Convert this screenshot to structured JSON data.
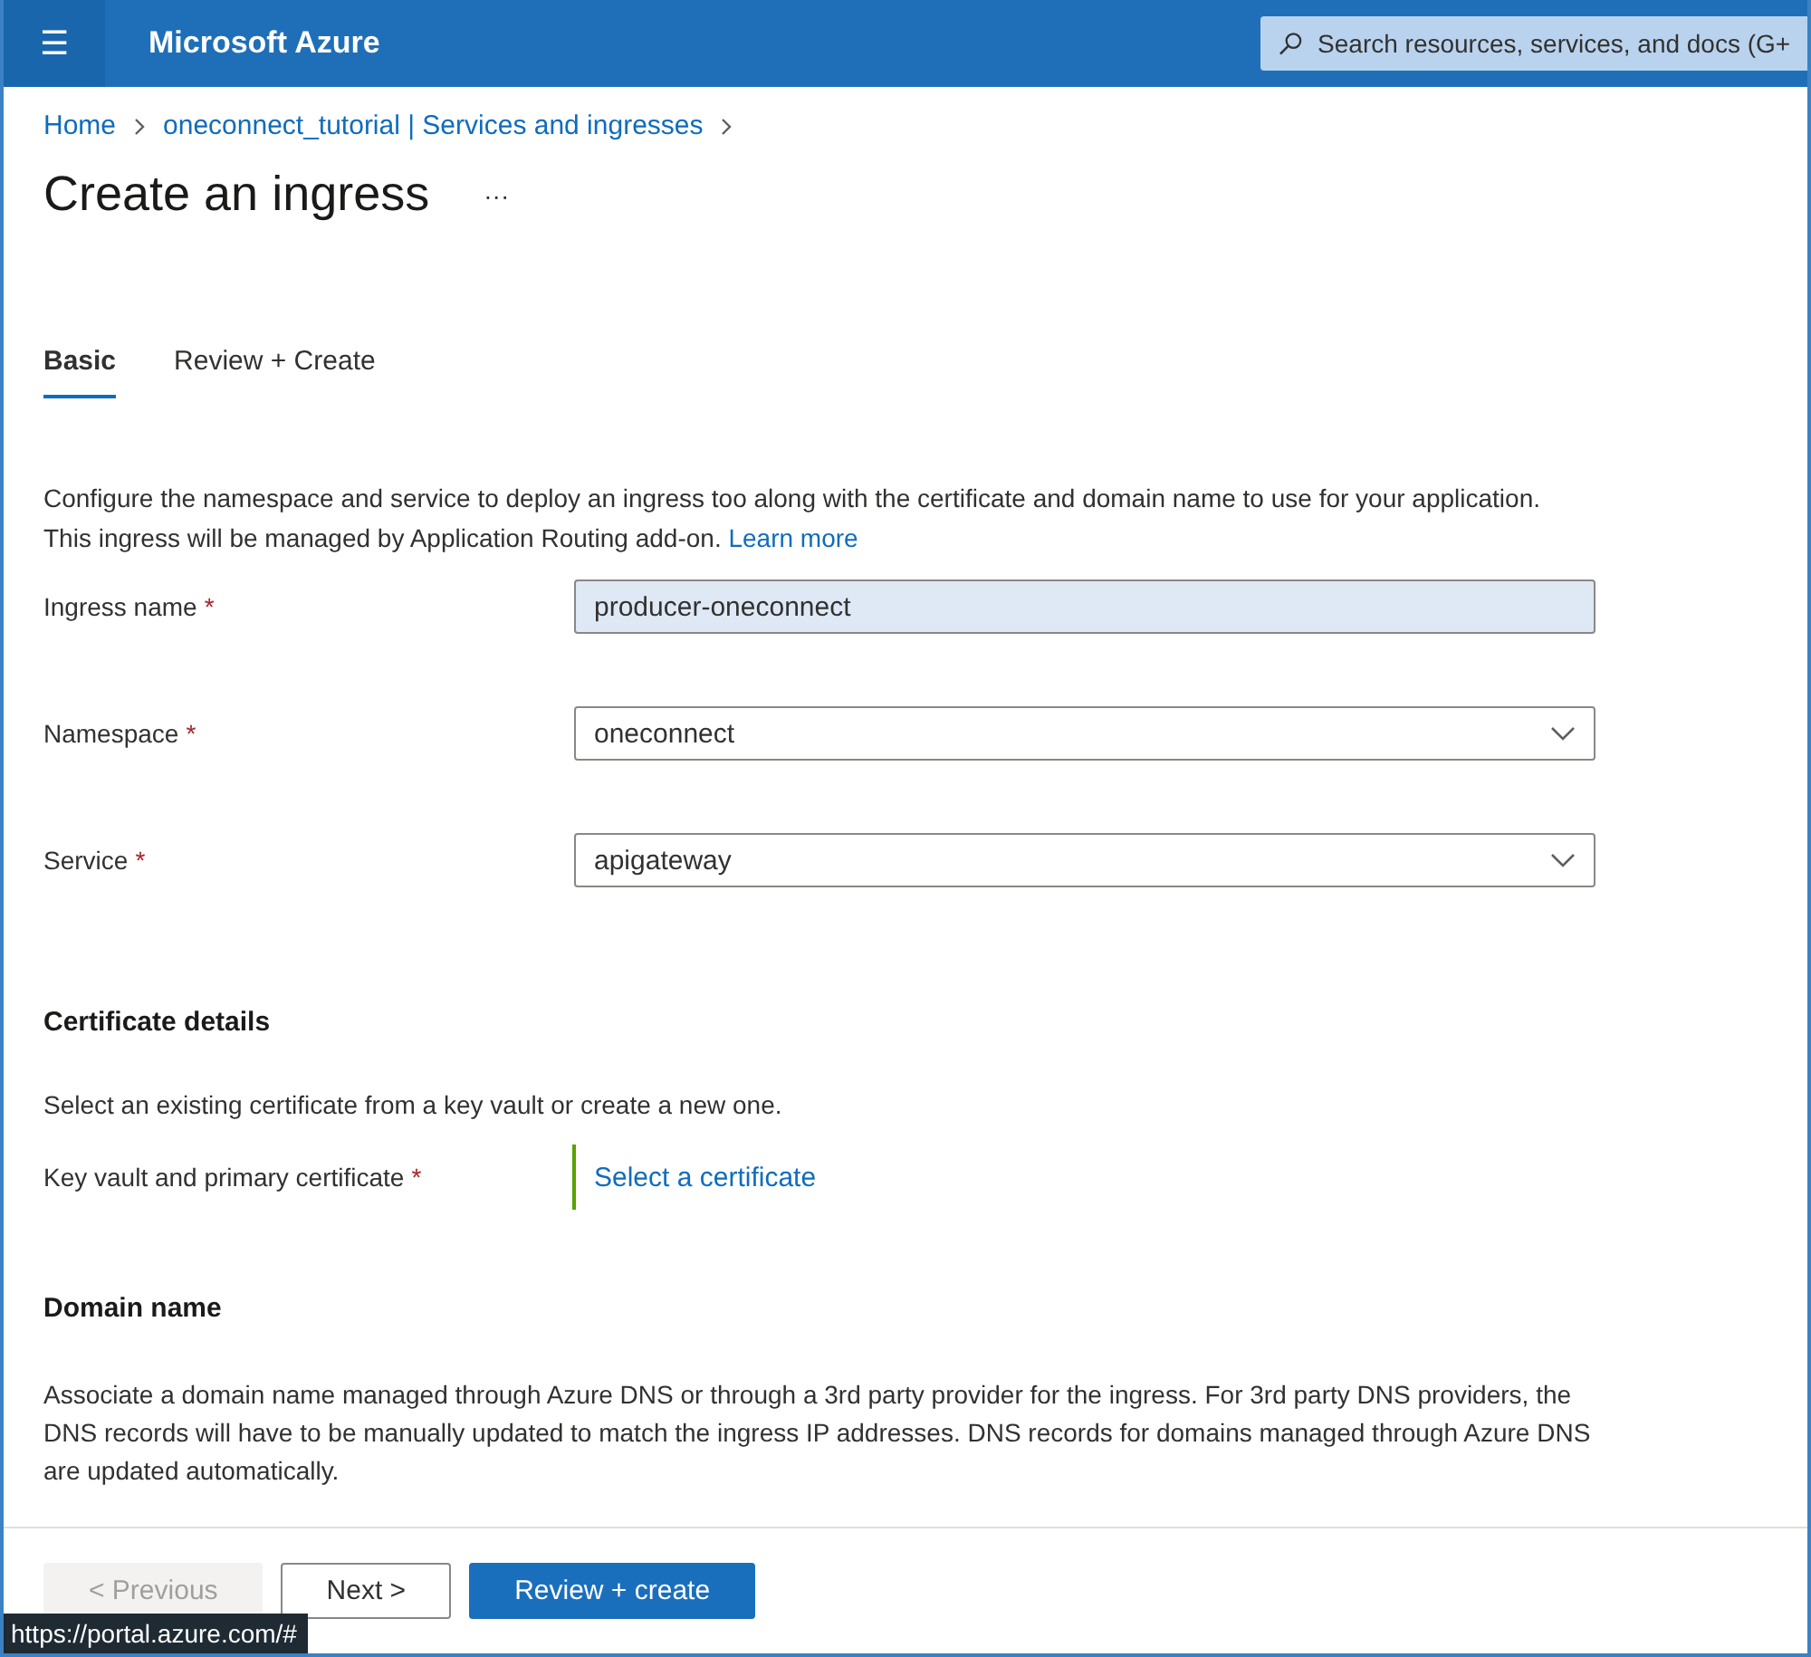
{
  "header": {
    "menu_icon": "☰",
    "brand": "Microsoft Azure",
    "search": {
      "placeholder": "Search resources, services, and docs (G+"
    }
  },
  "breadcrumb": [
    {
      "label": "Home"
    },
    {
      "label": "oneconnect_tutorial | Services and ingresses"
    }
  ],
  "page_title": "Create an ingress",
  "more": "···",
  "tabs": [
    {
      "label": "Basic",
      "selected": true
    },
    {
      "label": "Review + Create",
      "selected": false
    }
  ],
  "intro": {
    "text": "Configure the namespace and service to deploy an ingress too along with the certificate and domain name to use for your application. This ingress will be managed by Application Routing add-on.",
    "link": "Learn more"
  },
  "fields": [
    {
      "kind": "text",
      "label": "Ingress name",
      "required_mark": "*",
      "value": "producer-oneconnect"
    },
    {
      "kind": "select",
      "label": "Namespace",
      "required_mark": "*",
      "value": "oneconnect"
    },
    {
      "kind": "select",
      "label": "Service",
      "required_mark": "*",
      "value": "apigateway"
    }
  ],
  "certificate": {
    "heading": "Certificate details",
    "text": "Select an existing certificate from a key vault or create a new one.",
    "field": {
      "kind": "picker",
      "label": "Key vault and primary certificate",
      "required_mark": "*",
      "value": "Select a certificate"
    }
  },
  "domain": {
    "heading": "Domain name",
    "text": "Associate a domain name managed through Azure DNS or through a 3rd party provider for the ingress. For 3rd party DNS providers, the DNS records will have to be manually updated to match the ingress IP addresses. DNS records for domains managed through Azure DNS are updated automatically."
  },
  "footer_buttons": [
    {
      "kind": "secondary",
      "label": "< Previous",
      "disabled": true
    },
    {
      "kind": "secondary",
      "label": "Next >",
      "disabled": false
    },
    {
      "kind": "primary",
      "label": "Review + create",
      "disabled": false
    }
  ],
  "status_bar": {
    "url": "https://portal.azure.com/#"
  }
}
